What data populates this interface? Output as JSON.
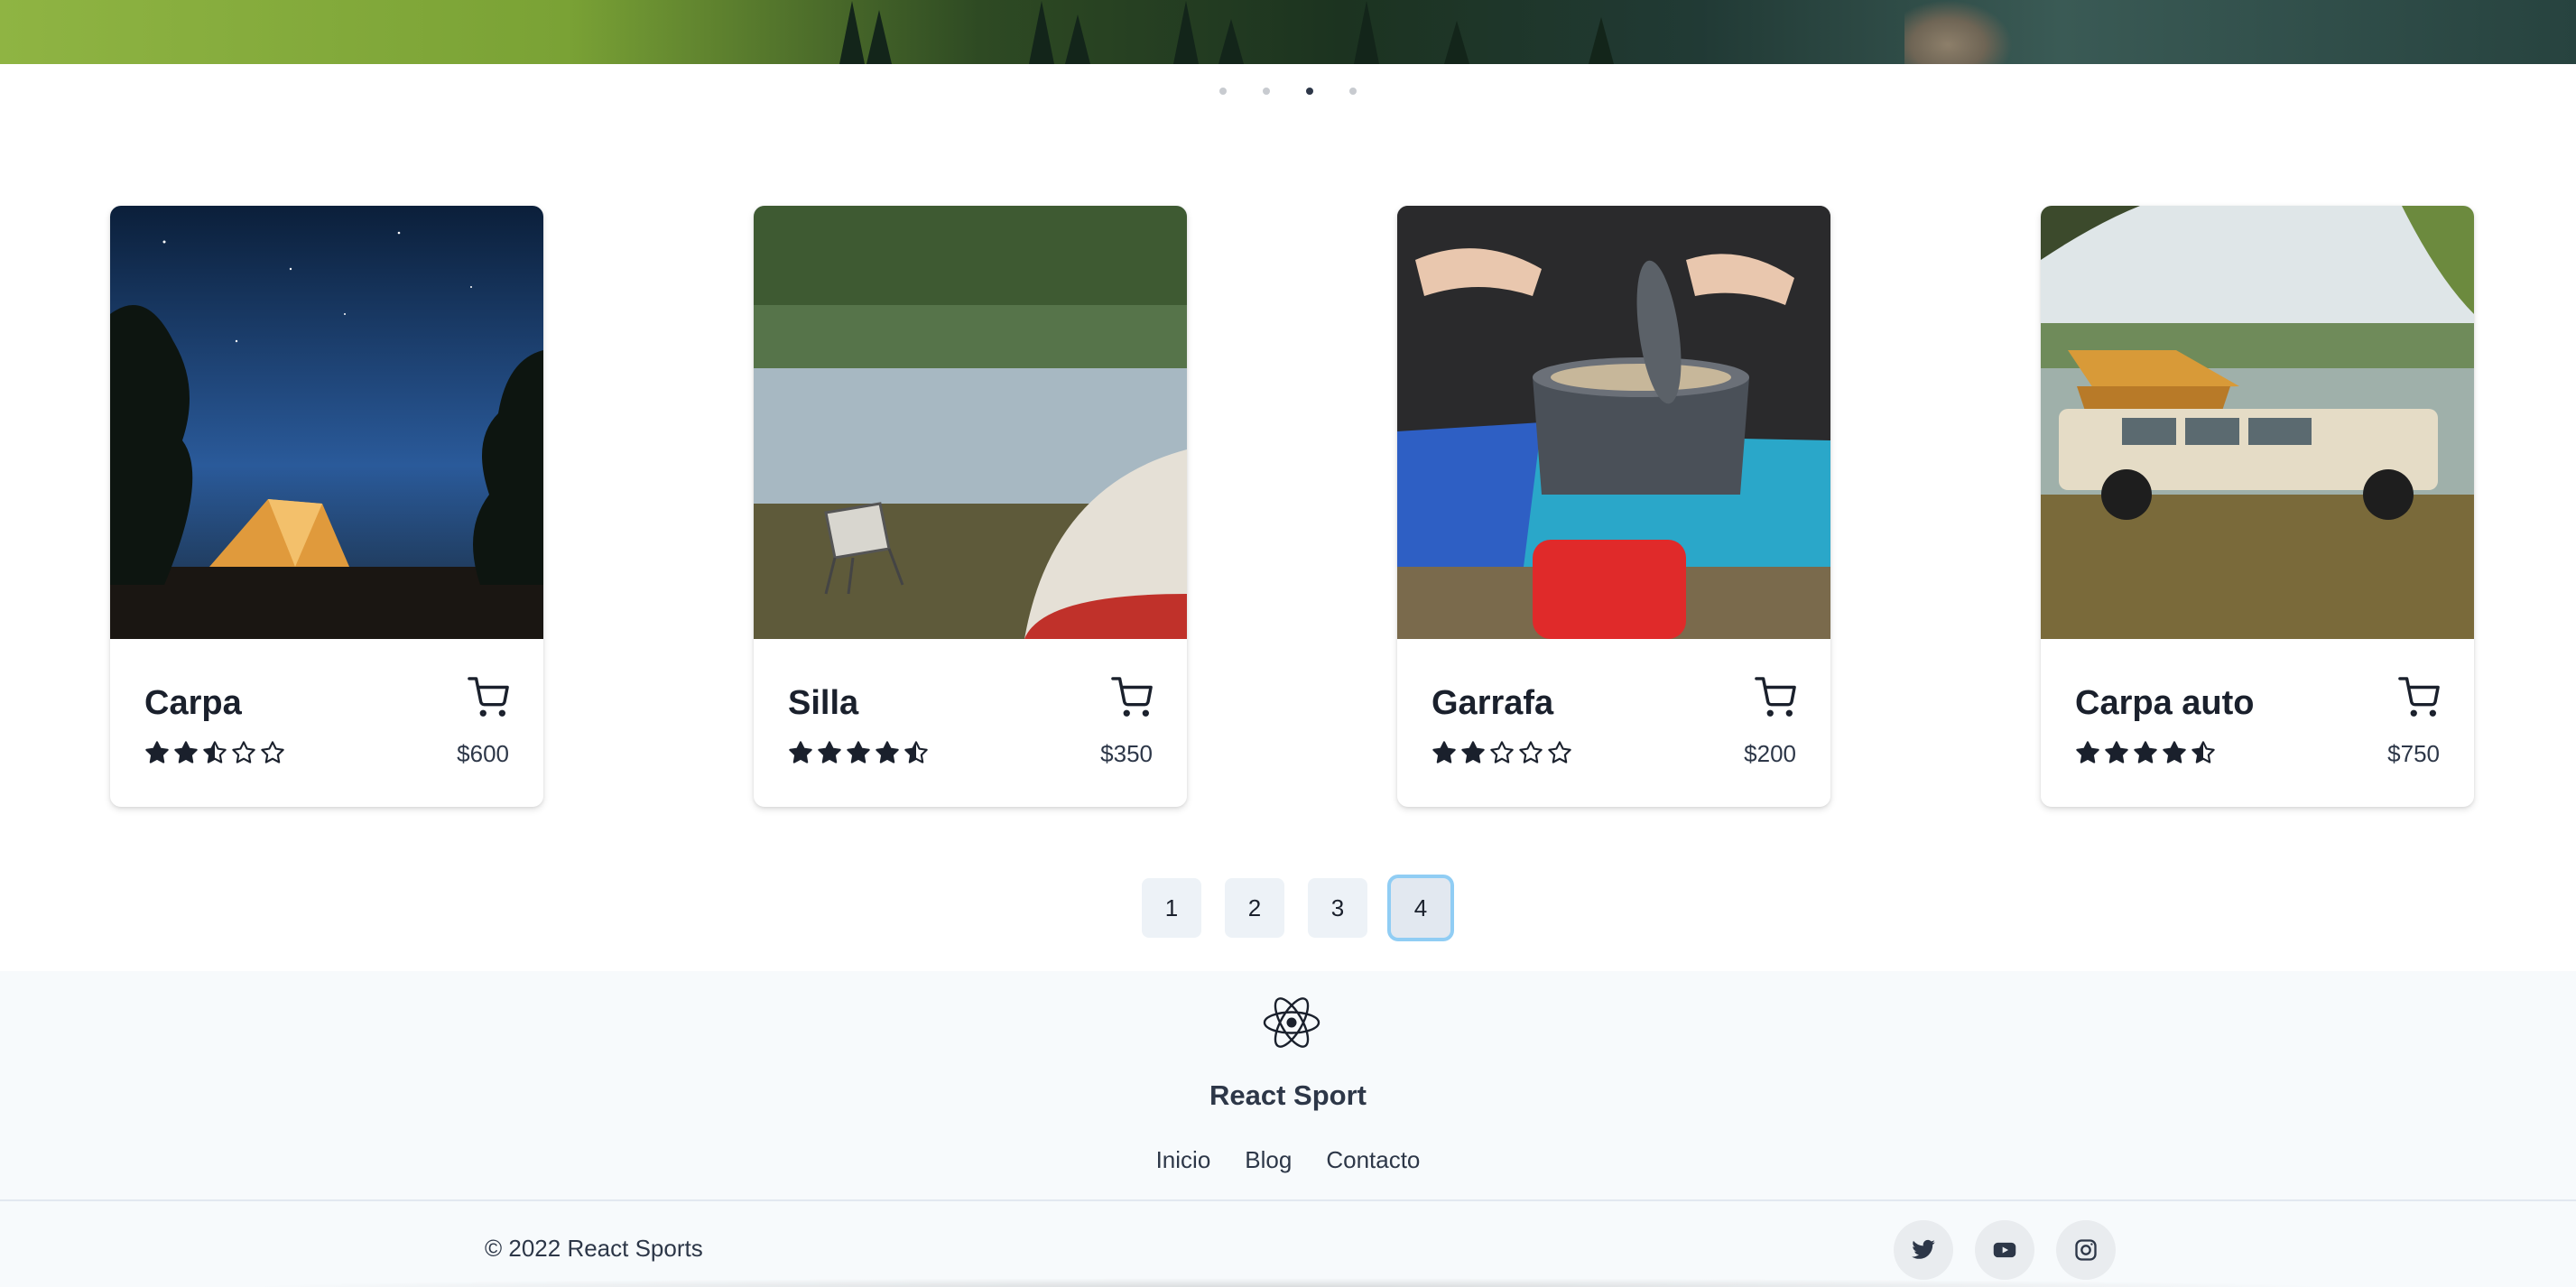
{
  "carousel": {
    "dots": [
      false,
      false,
      true,
      false
    ]
  },
  "products": [
    {
      "name": "Carpa",
      "price": "$600",
      "rating": 2.5,
      "image": "tent-night"
    },
    {
      "name": "Silla",
      "price": "$350",
      "rating": 4.5,
      "image": "chair-lake"
    },
    {
      "name": "Garrafa",
      "price": "$200",
      "rating": 2,
      "image": "camp-stove"
    },
    {
      "name": "Carpa auto",
      "price": "$750",
      "rating": 4.5,
      "image": "roof-tent-car"
    }
  ],
  "pagination": {
    "pages": [
      "1",
      "2",
      "3",
      "4"
    ],
    "current": "4"
  },
  "footer": {
    "brand": "React Sport",
    "links": [
      "Inicio",
      "Blog",
      "Contacto"
    ],
    "copyright": "© 2022 React Sports",
    "social": [
      "twitter-icon",
      "youtube-icon",
      "instagram-icon"
    ]
  },
  "colors": {
    "text": "#1a202c",
    "footer_bg": "#f7fafc",
    "active_ring": "#90cdf4"
  }
}
